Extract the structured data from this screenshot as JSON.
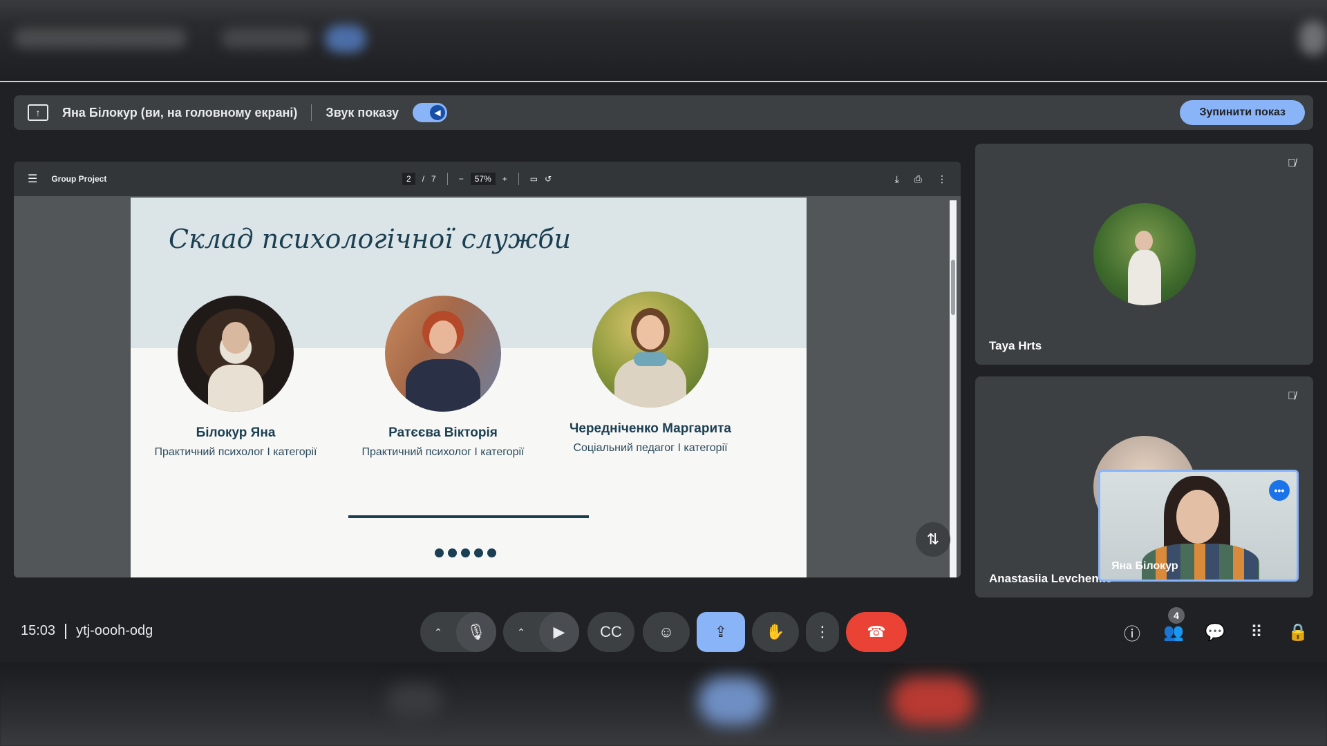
{
  "sharing_banner": {
    "presenter_text": "Яна Білокур (ви, на головному екрані)",
    "sound_label": "Звук показу",
    "stop_button": "Зупинити показ"
  },
  "pdf_viewer": {
    "title": "Group Project",
    "page_current": "2",
    "page_separator": "/",
    "page_total": "7",
    "zoom": "57%"
  },
  "slide": {
    "title": "Склад психологічної служби",
    "people": [
      {
        "name": "Білокур Яна",
        "role": "Практичний психолог І категорії"
      },
      {
        "name": "Ратєєва Вікторія",
        "role": "Практичний психолог І категорії"
      },
      {
        "name": "Чередніченко Маргарита",
        "role": "Соціальний педагог І категорії"
      }
    ],
    "accent_color": "#1b3f52"
  },
  "participants": [
    {
      "name": "Taya Hrts",
      "muted": true
    },
    {
      "name": "Anastasiia Levchenko",
      "muted": true
    }
  ],
  "self_view": {
    "name": "Яна Білокур"
  },
  "meeting": {
    "time": "15:03",
    "code": "ytj-oooh-odg",
    "participant_count": "4"
  },
  "colors": {
    "background": "#202124",
    "tile": "#3c4043",
    "accent_blue": "#8ab4f8",
    "end_call_red": "#ea4335"
  }
}
